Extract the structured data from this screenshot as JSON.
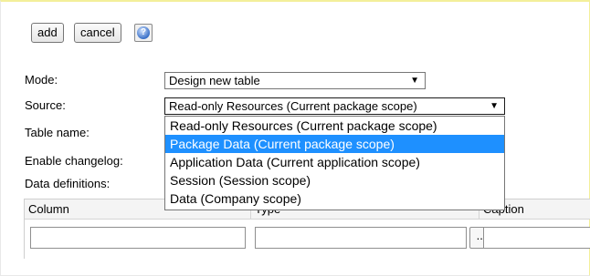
{
  "toolbar": {
    "add_label": "add",
    "cancel_label": "cancel",
    "help_icon": "help-icon"
  },
  "form": {
    "mode_label": "Mode:",
    "mode_value": "Design new table",
    "source_label": "Source:",
    "source_value": "Read-only Resources (Current package scope)",
    "table_name_label": "Table name:",
    "changelog_label": "Enable changelog:",
    "data_definitions_label": "Data definitions:"
  },
  "source_dropdown": {
    "options": [
      "Read-only Resources (Current package scope)",
      "Package Data (Current package scope)",
      "Application Data (Current application scope)",
      "Session (Session scope)",
      "Data (Company scope)"
    ],
    "highlighted_index": 1
  },
  "grid": {
    "headers": [
      "Column",
      "Type",
      "Caption"
    ],
    "ellipsis_label": "..."
  },
  "colors": {
    "highlight": "#1e90ff",
    "frame_accent": "#f3ef9a"
  }
}
